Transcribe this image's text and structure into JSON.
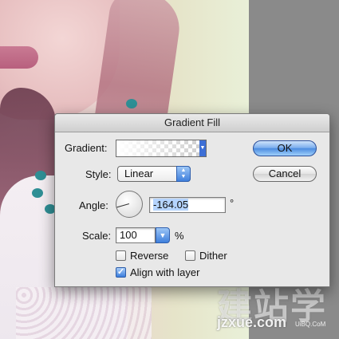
{
  "dialog": {
    "title": "Gradient Fill",
    "gradient_label": "Gradient:",
    "style_label": "Style:",
    "style_value": "Linear",
    "angle_label": "Angle:",
    "angle_value": "-164.05",
    "angle_unit": "°",
    "scale_label": "Scale:",
    "scale_value": "100",
    "scale_unit": "%",
    "reverse_label": "Reverse",
    "reverse_checked": false,
    "dither_label": "Dither",
    "dither_checked": false,
    "align_label": "Align with layer",
    "align_checked": true,
    "ok_label": "OK",
    "cancel_label": "Cancel"
  },
  "icons": {
    "gradient_dropdown": "triangle-down",
    "style_stepper": "up-down-arrows",
    "scale_dropdown": "triangle-down",
    "checkmark": "checkmark"
  },
  "colors": {
    "default_button": "#4d8de0",
    "popup_accent": "#3f7fdc"
  },
  "watermark": {
    "logo": "建站学",
    "url": "jzxue.com",
    "small": "UiBQ.CoM"
  }
}
